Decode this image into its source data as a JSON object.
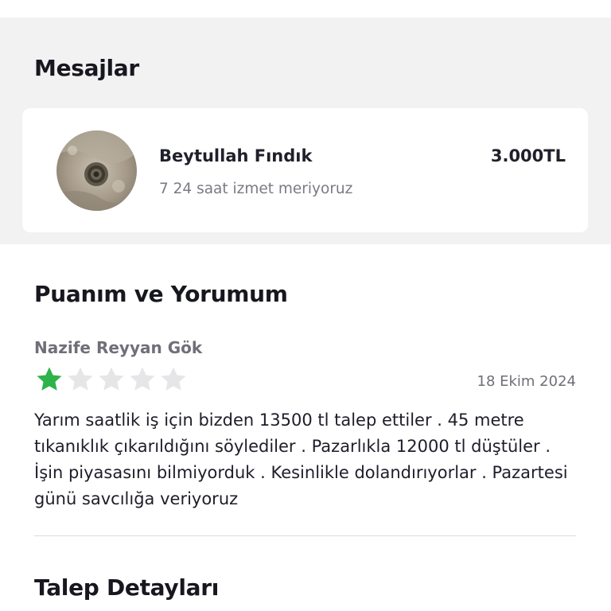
{
  "messages": {
    "title": "Mesajlar",
    "items": [
      {
        "sender": "Beytullah Fındık",
        "price": "3.000TL",
        "snippet": "7 24 saat izmet meriyoruz",
        "avatar_icon": "drain-photo-avatar"
      }
    ]
  },
  "review": {
    "title": "Puanım ve Yorumum",
    "reviewer": "Nazife Reyyan Gök",
    "rating": 1,
    "max_rating": 5,
    "date": "18 Ekim 2024",
    "text": "Yarım saatlik iş için bizden 13500 tl talep ettiler . 45 metre tıkanıklık çıkarıldığını söylediler . Pazarlıkla 12000 tl düştüler . İşin piyasasını bilmiyorduk . Kesinlikle dolandırıyorlar . Pazartesi günü savcılığa veriyoruz"
  },
  "details": {
    "title": "Talep Detayları"
  },
  "colors": {
    "star_filled": "#2db34a",
    "star_empty": "#e6e6e8",
    "section_bg": "#f2f2f2"
  }
}
